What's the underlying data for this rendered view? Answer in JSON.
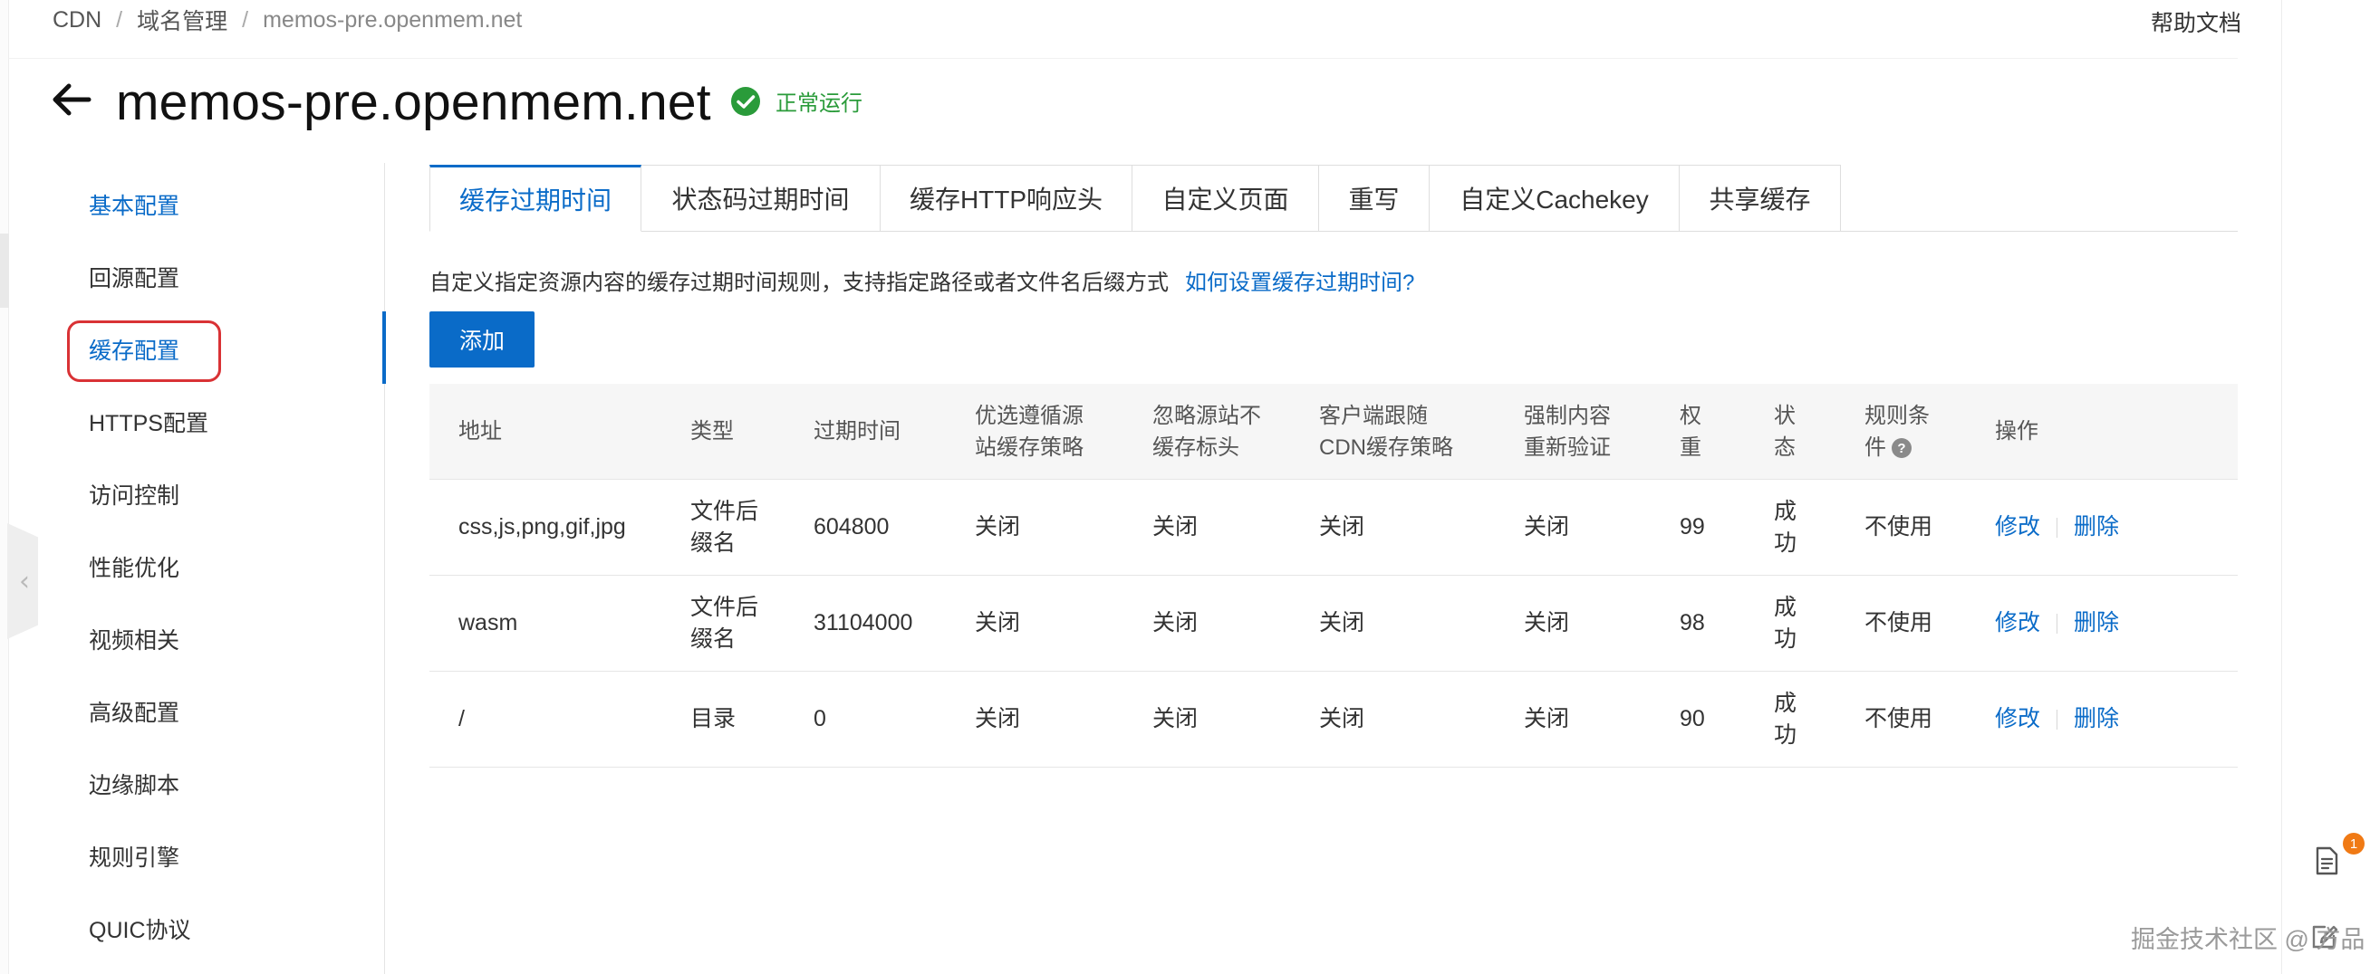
{
  "breadcrumb": {
    "item1": "CDN",
    "item2": "域名管理",
    "item3": "memos-pre.openmem.net",
    "sep": "/"
  },
  "header": {
    "help": "帮助文档",
    "title": "memos-pre.openmem.net",
    "status": "正常运行"
  },
  "sidebar": {
    "items": [
      {
        "label": "基本配置"
      },
      {
        "label": "回源配置"
      },
      {
        "label": "缓存配置"
      },
      {
        "label": "HTTPS配置"
      },
      {
        "label": "访问控制"
      },
      {
        "label": "性能优化"
      },
      {
        "label": "视频相关"
      },
      {
        "label": "高级配置"
      },
      {
        "label": "边缘脚本"
      },
      {
        "label": "规则引擎"
      },
      {
        "label": "QUIC协议"
      }
    ]
  },
  "tabs": [
    {
      "label": "缓存过期时间"
    },
    {
      "label": "状态码过期时间"
    },
    {
      "label": "缓存HTTP响应头"
    },
    {
      "label": "自定义页面"
    },
    {
      "label": "重写"
    },
    {
      "label": "自定义Cachekey"
    },
    {
      "label": "共享缓存"
    }
  ],
  "description": {
    "text": "自定义指定资源内容的缓存过期时间规则，支持指定路径或者文件名后缀方式",
    "link": "如何设置缓存过期时间?"
  },
  "toolbar": {
    "add_label": "添加"
  },
  "table": {
    "headers": {
      "address": "地址",
      "type": "类型",
      "expire": "过期时间",
      "follow_origin": "优选遵循源\n站缓存策略",
      "ignore_origin": "忽略源站不\n缓存标头",
      "client_follow": "客户端跟随\nCDN缓存策略",
      "revalidate": "强制内容\n重新验证",
      "weight": "权\n重",
      "state": "状\n态",
      "condition": "规则条\n件",
      "actions": "操作"
    },
    "rows": [
      {
        "address": "css,js,png,gif,jpg",
        "type": "文件后\n缀名",
        "expire": "604800",
        "follow_origin": "关闭",
        "ignore_origin": "关闭",
        "client_follow": "关闭",
        "revalidate": "关闭",
        "weight": "99",
        "state": "成\n功",
        "condition": "不使用",
        "edit": "修改",
        "delete": "删除"
      },
      {
        "address": "wasm",
        "type": "文件后\n缀名",
        "expire": "31104000",
        "follow_origin": "关闭",
        "ignore_origin": "关闭",
        "client_follow": "关闭",
        "revalidate": "关闭",
        "weight": "98",
        "state": "成\n功",
        "condition": "不使用",
        "edit": "修改",
        "delete": "删除"
      },
      {
        "address": "/",
        "type": "目录",
        "expire": "0",
        "follow_origin": "关闭",
        "ignore_origin": "关闭",
        "client_follow": "关闭",
        "revalidate": "关闭",
        "weight": "90",
        "state": "成\n功",
        "condition": "不使用",
        "edit": "修改",
        "delete": "删除"
      }
    ]
  },
  "floating": {
    "badge": "1"
  },
  "watermark": "掘金技术社区 @ 方品",
  "colors": {
    "accent": "#0a6bc8",
    "success": "#2a9b3a",
    "highlight_border": "#d93235",
    "badge": "#f07a15"
  },
  "icons": {
    "back": "arrow-left-icon",
    "status": "check-circle-icon",
    "help": "question-circle-icon",
    "doc": "document-icon",
    "edit": "edit-icon",
    "collapse": "chevron-left-icon"
  }
}
